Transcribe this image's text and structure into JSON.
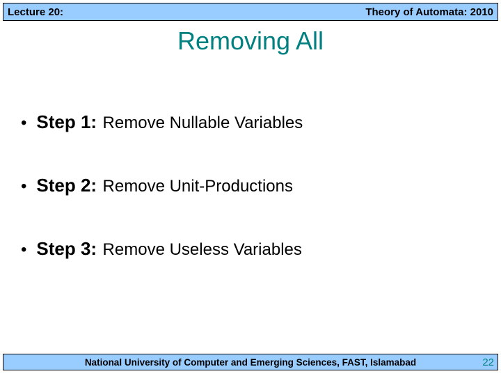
{
  "header": {
    "left": "Lecture 20:",
    "right": "Theory of Automata: 2010"
  },
  "title": "Removing All",
  "steps": [
    {
      "label": "Step 1:",
      "text": "Remove Nullable Variables"
    },
    {
      "label": "Step 2:",
      "text": "Remove Unit-Productions"
    },
    {
      "label": "Step 3:",
      "text": "Remove Useless Variables"
    }
  ],
  "footer": {
    "text": "National University of Computer and Emerging Sciences, FAST, Islamabad",
    "page": "22"
  }
}
